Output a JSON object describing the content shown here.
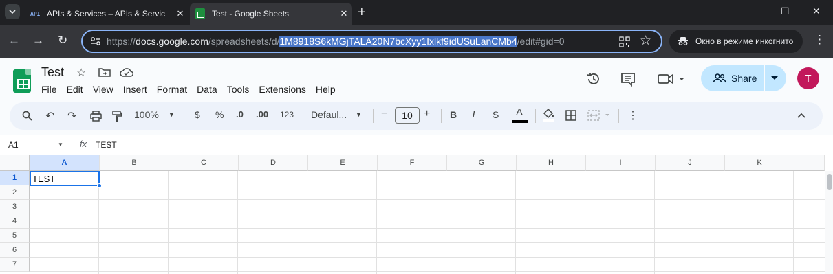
{
  "browser": {
    "tabs": [
      {
        "favicon": "API",
        "title": "APIs & Services – APIs & Servic"
      },
      {
        "title": "Test - Google Sheets"
      }
    ],
    "new_tab": "+",
    "window_controls": {
      "minimize": "—",
      "maximize": "☐",
      "close": "✕"
    },
    "url": {
      "prefix": "https://",
      "host": "docs.google.com",
      "path_before": "/spreadsheets/d/",
      "selected": "1M8918S6kMGjTALA20N7bcXyy1Ixlkf9idUSuLanCMb4",
      "path_after": "/edit#gid=0"
    },
    "incognito_label": "Окно в режиме инкогнито"
  },
  "sheets": {
    "doc_title": "Test",
    "menu": [
      "File",
      "Edit",
      "View",
      "Insert",
      "Format",
      "Data",
      "Tools",
      "Extensions",
      "Help"
    ],
    "share_label": "Share",
    "avatar_letter": "T",
    "toolbar": {
      "zoom": "100%",
      "currency": "$",
      "percent": "%",
      "decrease_decimal": ".0",
      "increase_decimal": ".00",
      "number_format": "123",
      "font": "Defaul...",
      "font_size": "10",
      "bold": "B",
      "italic": "I",
      "strikethrough": "S",
      "text_color": "A"
    },
    "formula_bar": {
      "name_box": "A1",
      "fx": "fx",
      "value": "TEST"
    },
    "columns": [
      "A",
      "B",
      "C",
      "D",
      "E",
      "F",
      "G",
      "H",
      "I",
      "J",
      "K"
    ],
    "rows": [
      "1",
      "2",
      "3",
      "4",
      "5",
      "6",
      "7"
    ],
    "cell_a1": "TEST",
    "accent": "#1a73e8",
    "brand_green": "#0f9d58"
  }
}
